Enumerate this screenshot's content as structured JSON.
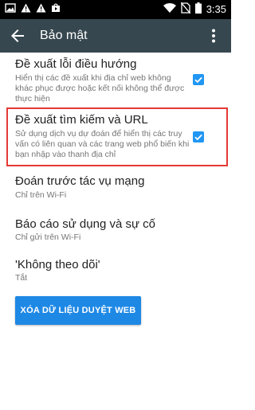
{
  "status_bar": {
    "time": "3:35",
    "icons": [
      "image-icon",
      "warning-icon",
      "warning-icon",
      "play-store-icon",
      "wifi-icon",
      "no-sim-icon",
      "battery-icon"
    ]
  },
  "app_bar": {
    "title": "Bảo mật",
    "icons": [
      "back-arrow-icon",
      "overflow-menu-icon"
    ]
  },
  "settings": {
    "nav_error": {
      "title": "Đề xuất lỗi điều hướng",
      "summary": "Hiển thị các đề xuất khi địa chỉ web không khác phục được hoặc kết nối không thể được thực hiện",
      "checked": true
    },
    "search_url": {
      "title": "Đề xuất tìm kiếm và URL",
      "summary": "Sử dụng dịch vụ dự đoán để hiển thị các truy vấn có liên quan và các trang web phổ biến khi bạn nhập vào thanh địa chỉ",
      "checked": true
    },
    "prefetch": {
      "title": "Đoán trước tác vụ mạng",
      "summary": "Chỉ trên Wi-Fi"
    },
    "usage_report": {
      "title": "Báo cáo sử dụng và sự cố",
      "summary": "Chỉ gửi trên Wi-Fi"
    },
    "do_not_track": {
      "title": "'Không theo dõi'",
      "summary": "Tắt"
    }
  },
  "clear_button_label": "XÓA DỮ LIỆU DUYỆT WEB",
  "colors": {
    "status_bar": "#000000",
    "app_bar": "#37474f",
    "accent": "#2196f3",
    "highlight": "#e53935"
  }
}
